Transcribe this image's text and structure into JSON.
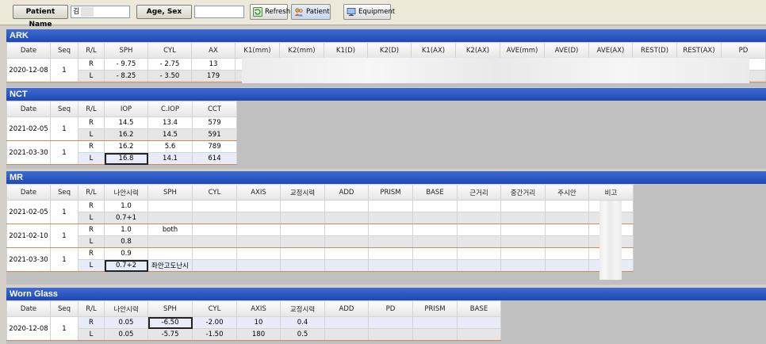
{
  "toolbar": {
    "patient_name_label": "Patient Name",
    "patient_name_value": "김",
    "age_sex_label": "Age, Sex",
    "age_sex_value": "",
    "refresh_label": "Refresh",
    "patient_label": "Patient",
    "equipment_label": "Equipment"
  },
  "ark": {
    "title": "ARK",
    "headers": [
      "Date",
      "Seq",
      "R/L",
      "SPH",
      "CYL",
      "AX",
      "K1(mm)",
      "K2(mm)",
      "K1(D)",
      "K2(D)",
      "K1(AX)",
      "K2(AX)",
      "AVE(mm)",
      "AVE(D)",
      "AVE(AX)",
      "REST(D)",
      "REST(AX)",
      "PD"
    ],
    "groups": [
      {
        "date": "2020-12-08",
        "seq": "1",
        "rows": [
          {
            "rl": "R",
            "sph": "- 9.75",
            "cyl": "- 2.75",
            "ax": "13"
          },
          {
            "rl": "L",
            "sph": "- 8.25",
            "cyl": "- 3.50",
            "ax": "179"
          }
        ]
      }
    ]
  },
  "nct": {
    "title": "NCT",
    "headers": [
      "Date",
      "Seq",
      "R/L",
      "IOP",
      "C.IOP",
      "CCT"
    ],
    "groups": [
      {
        "date": "2021-02-05",
        "seq": "1",
        "rows": [
          {
            "rl": "R",
            "iop": "14.5",
            "ciop": "13.4",
            "cct": "579"
          },
          {
            "rl": "L",
            "iop": "16.2",
            "ciop": "14.5",
            "cct": "591"
          }
        ]
      },
      {
        "date": "2021-03-30",
        "seq": "1",
        "rows": [
          {
            "rl": "R",
            "iop": "16.2",
            "ciop": "5.6",
            "cct": "789"
          },
          {
            "rl": "L",
            "iop": "16.8",
            "ciop": "14.1",
            "cct": "614"
          }
        ]
      }
    ]
  },
  "mr": {
    "title": "MR",
    "headers": [
      "Date",
      "Seq",
      "R/L",
      "나안시력",
      "SPH",
      "CYL",
      "AXIS",
      "교정시력",
      "ADD",
      "PRISM",
      "BASE",
      "근거리",
      "중간거리",
      "주시안",
      "비고"
    ],
    "groups": [
      {
        "date": "2021-02-05",
        "seq": "1",
        "rows": [
          {
            "rl": "R",
            "va": "1.0",
            "sph": ""
          },
          {
            "rl": "L",
            "va": "0.7+1",
            "sph": ""
          }
        ]
      },
      {
        "date": "2021-02-10",
        "seq": "1",
        "rows": [
          {
            "rl": "R",
            "va": "1.0",
            "sph": "both"
          },
          {
            "rl": "L",
            "va": "0.8",
            "sph": ""
          }
        ]
      },
      {
        "date": "2021-03-30",
        "seq": "1",
        "rows": [
          {
            "rl": "R",
            "va": "0.9",
            "sph": ""
          },
          {
            "rl": "L",
            "va": "0.7+2",
            "sph": "좌안고도난시"
          }
        ]
      }
    ]
  },
  "worn": {
    "title": "Worn Glass",
    "headers": [
      "Date",
      "Seq",
      "R/L",
      "나안시력",
      "SPH",
      "CYL",
      "AXIS",
      "교정시력",
      "ADD",
      "PD",
      "PRISM",
      "BASE"
    ],
    "groups": [
      {
        "date": "2020-12-08",
        "seq": "1",
        "rows": [
          {
            "rl": "R",
            "va": "0.05",
            "sph": "-6.50",
            "cyl": "-2.00",
            "axis": "10",
            "cva": "0.4"
          },
          {
            "rl": "L",
            "va": "0.05",
            "sph": "-5.75",
            "cyl": "-1.50",
            "axis": "180",
            "cva": "0.5"
          }
        ]
      }
    ]
  }
}
